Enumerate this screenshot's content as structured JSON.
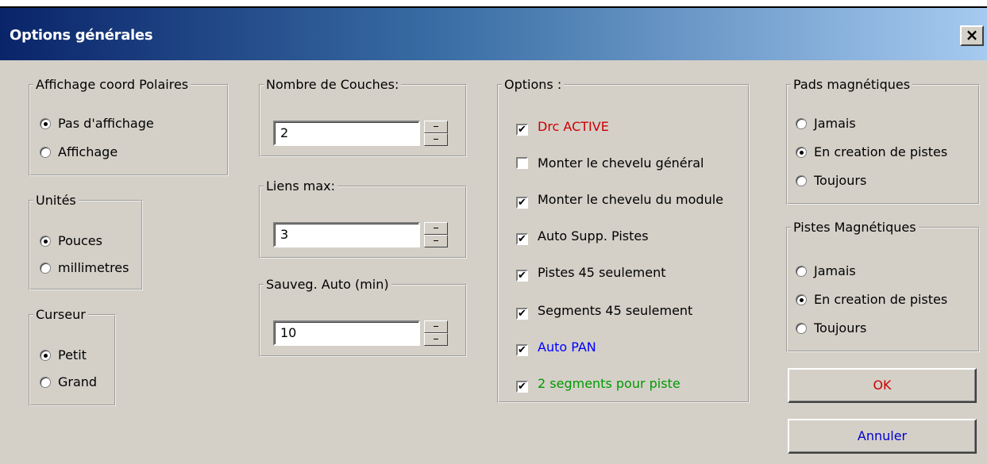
{
  "window": {
    "title": "Options générales",
    "close_label": "×"
  },
  "polar": {
    "legend": "Affichage coord Polaires",
    "options": [
      "Pas d'affichage",
      "Affichage"
    ],
    "selected": 0
  },
  "units": {
    "legend": "Unités",
    "options": [
      "Pouces",
      "millimetres"
    ],
    "selected": 0
  },
  "cursor": {
    "legend": "Curseur",
    "options": [
      "Petit",
      "Grand"
    ],
    "selected": 0
  },
  "layers": {
    "legend": "Nombre de Couches:",
    "value": "2"
  },
  "links": {
    "legend": "Liens max:",
    "value": "3"
  },
  "autosave": {
    "legend": "Sauveg. Auto (min)",
    "value": "10"
  },
  "options": {
    "legend": "Options :",
    "items": [
      {
        "label": "Drc ACTIVE",
        "checked": true,
        "color": "#cc0000"
      },
      {
        "label": "Monter le chevelu général",
        "checked": false,
        "color": "#000000"
      },
      {
        "label": "Monter le chevelu du module",
        "checked": true,
        "color": "#000000"
      },
      {
        "label": "Auto Supp. Pistes",
        "checked": true,
        "color": "#000000"
      },
      {
        "label": "Pistes 45 seulement",
        "checked": true,
        "color": "#000000"
      },
      {
        "label": "Segments 45 seulement",
        "checked": true,
        "color": "#000000"
      },
      {
        "label": "Auto PAN",
        "checked": true,
        "color": "#0000ff"
      },
      {
        "label": "2 segments pour piste",
        "checked": true,
        "color": "#009900"
      }
    ]
  },
  "pads": {
    "legend": "Pads magnétiques",
    "options": [
      "Jamais",
      "En creation de pistes",
      "Toujours"
    ],
    "selected": 1
  },
  "tracks": {
    "legend": "Pistes Magnétiques",
    "options": [
      "Jamais",
      "En creation de pistes",
      "Toujours"
    ],
    "selected": 1
  },
  "buttons": {
    "ok": {
      "label": "OK",
      "color": "#cc0000"
    },
    "cancel": {
      "label": "Annuler",
      "color": "#0000cc"
    }
  },
  "icons": {
    "close": "close-icon",
    "spin_up": "spin-up-icon",
    "spin_down": "spin-down-icon",
    "check": "checkmark-icon"
  }
}
